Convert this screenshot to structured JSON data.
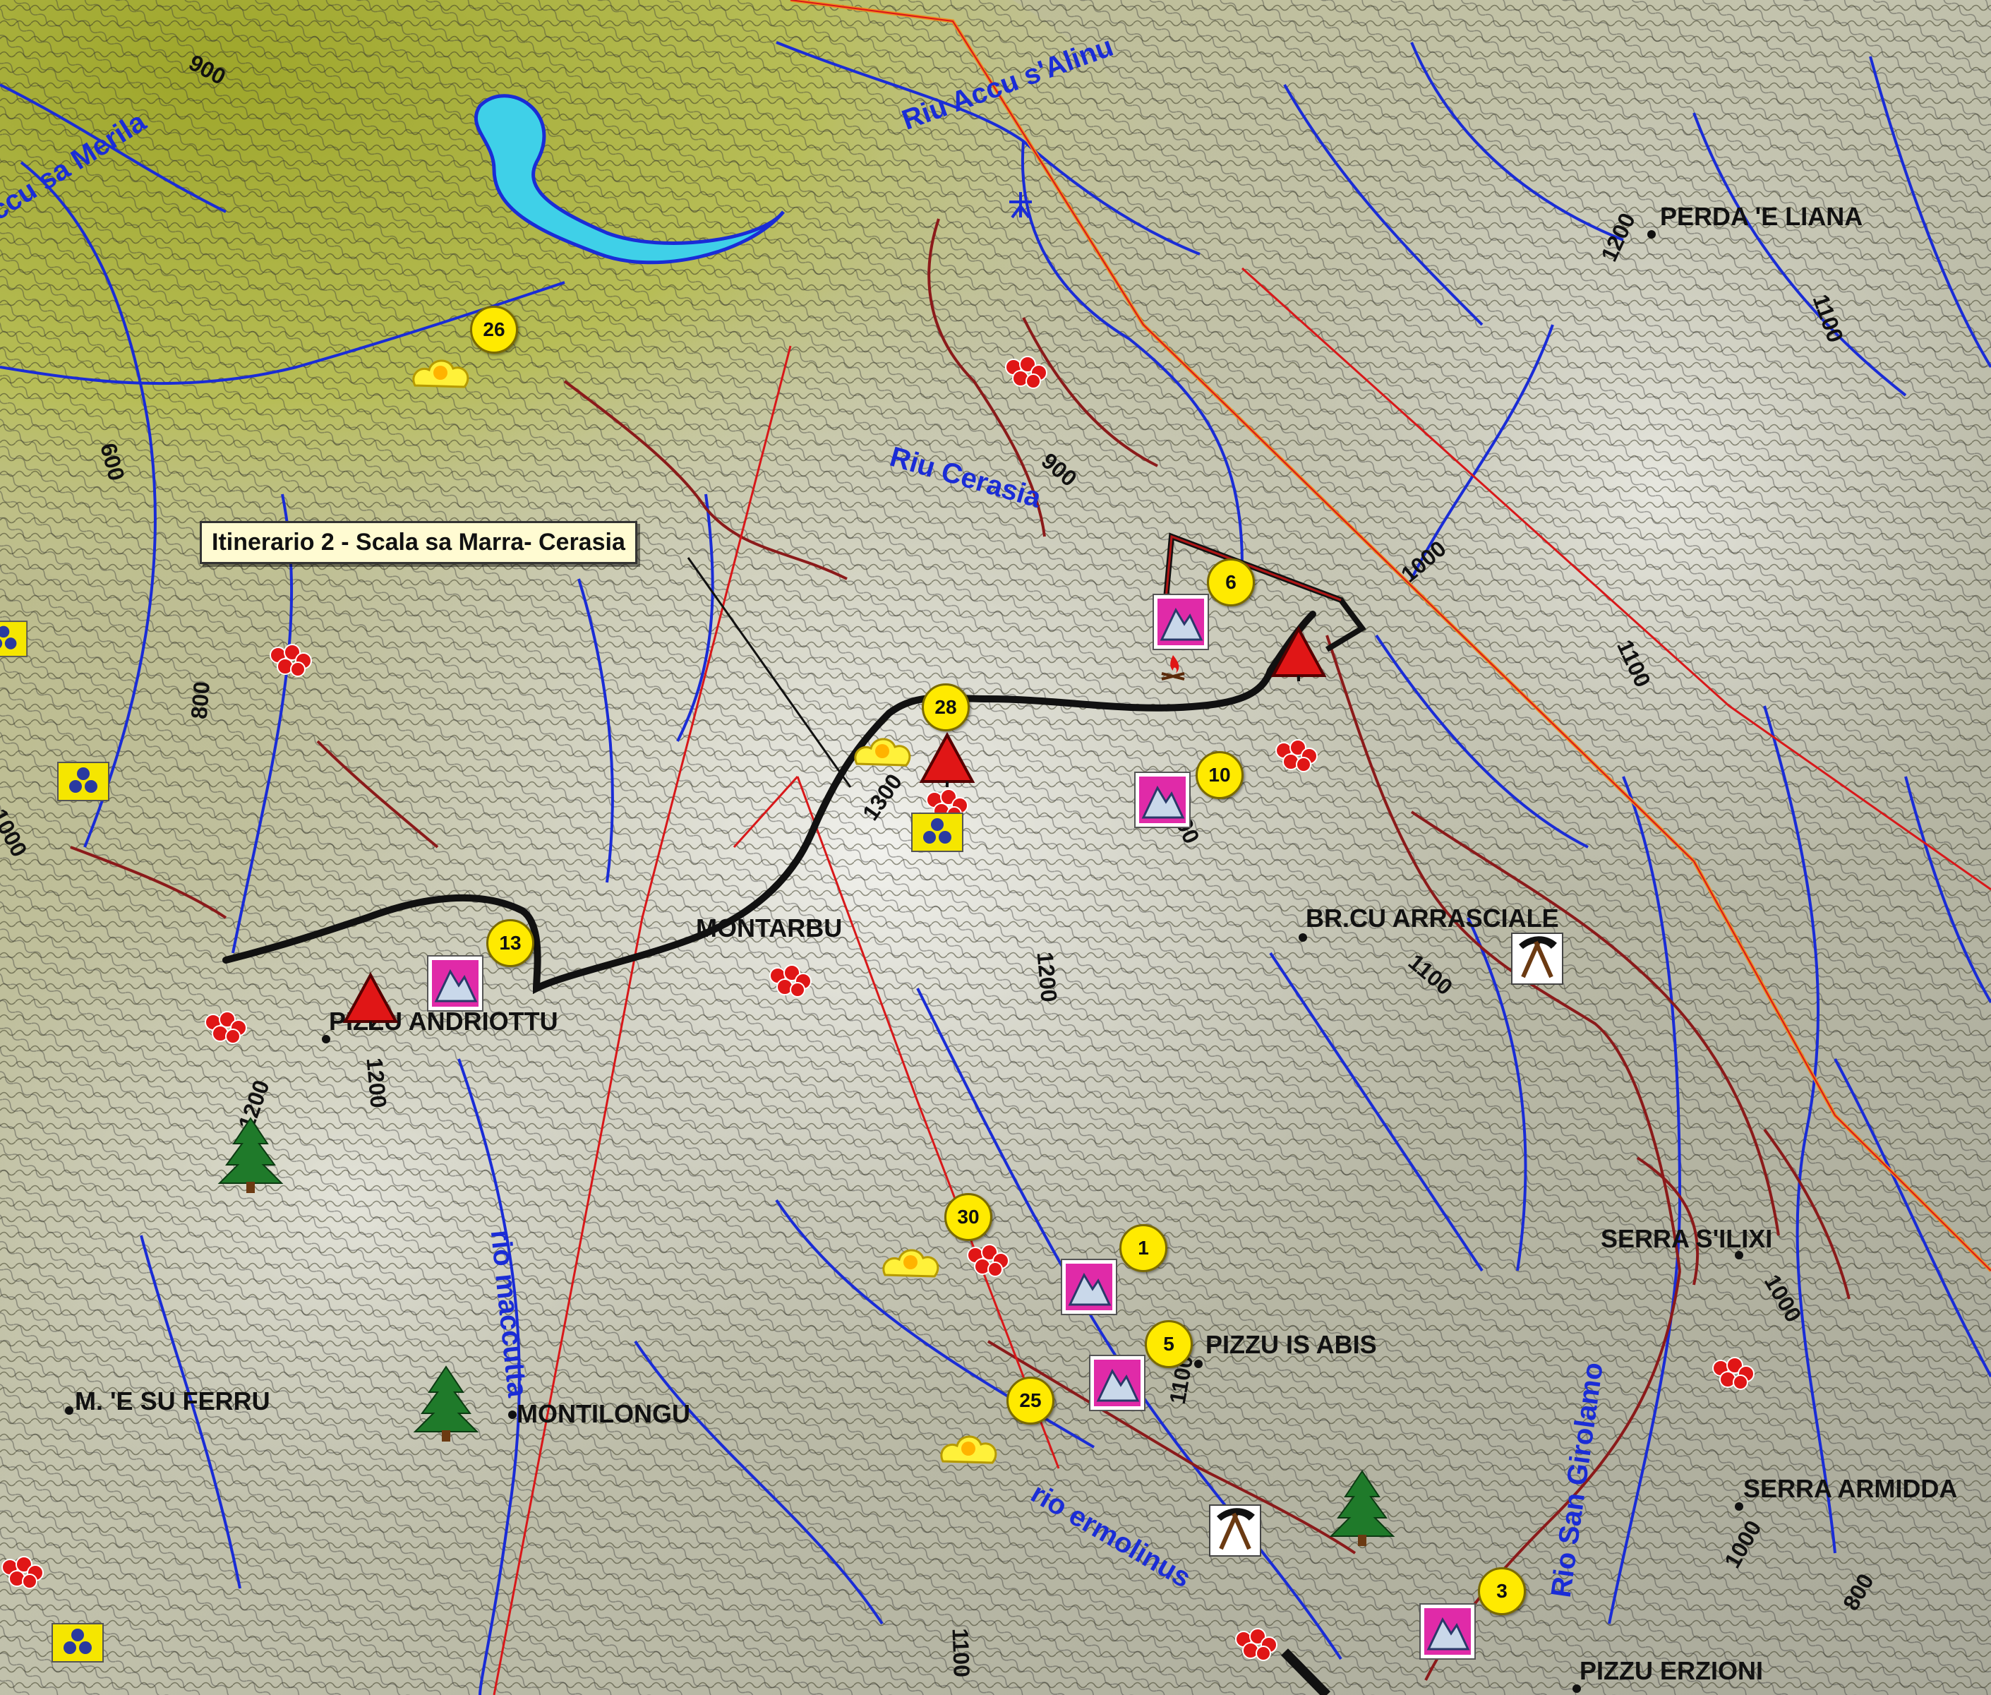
{
  "map": {
    "callout": "Itinerario 2 - Scala sa Marra- Cerasia",
    "places": [
      {
        "id": "perda-e-liana",
        "name": "PERDA 'E LIANA"
      },
      {
        "id": "br-cu-arrasciale",
        "name": "BR.CU ARRASCIALE"
      },
      {
        "id": "montarbu",
        "name": "MONTARBU"
      },
      {
        "id": "pizzu-andriottu",
        "name": "PIZZU ANDRIOTTU"
      },
      {
        "id": "serra-s-ilixi",
        "name": "SERRA S'ILIXI"
      },
      {
        "id": "pizzu-is-abis",
        "name": "PIZZU IS ABIS"
      },
      {
        "id": "m-e-su-ferru",
        "name": "M. 'E SU FERRU"
      },
      {
        "id": "montilongu",
        "name": "MONTILONGU"
      },
      {
        "id": "serra-armidda",
        "name": "SERRA ARMIDDA"
      },
      {
        "id": "pizzu-erzioni",
        "name": "PIZZU ERZIONI"
      }
    ],
    "rivers": [
      {
        "id": "riu-accu-s-alinu",
        "name": "Riu Accu s'Alinu"
      },
      {
        "id": "accu-sa-merila",
        "name": "ccu sa Merila"
      },
      {
        "id": "riu-cerasia",
        "name": "Riu Cerasia"
      },
      {
        "id": "rio-maccutta",
        "name": "rio maccutta"
      },
      {
        "id": "rio-ermolinus",
        "name": "rio ermolinus"
      },
      {
        "id": "rio-san-girolamo",
        "name": "Rio San Girolamo"
      }
    ],
    "contours": [
      {
        "id": "c900a",
        "value": "900"
      },
      {
        "id": "c600",
        "value": "600"
      },
      {
        "id": "c900b",
        "value": "900"
      },
      {
        "id": "c1000a",
        "value": "1000"
      },
      {
        "id": "c1200a",
        "value": "1200"
      },
      {
        "id": "c1100a",
        "value": "1100"
      },
      {
        "id": "c1100b",
        "value": "1100"
      },
      {
        "id": "c800a",
        "value": "800"
      },
      {
        "id": "c1000b",
        "value": "1000"
      },
      {
        "id": "c1300",
        "value": "1300"
      },
      {
        "id": "c1200b",
        "value": "1200"
      },
      {
        "id": "c1200c",
        "value": "1200"
      },
      {
        "id": "c1100c",
        "value": "1100"
      },
      {
        "id": "c1200d",
        "value": "1200"
      },
      {
        "id": "c1200e",
        "value": "1200"
      },
      {
        "id": "c1000c",
        "value": "1000"
      },
      {
        "id": "c1100d",
        "value": "1100"
      },
      {
        "id": "c1000d",
        "value": "1000"
      },
      {
        "id": "c800b",
        "value": "800"
      },
      {
        "id": "c1100e",
        "value": "1100"
      }
    ],
    "waypoints": [
      "26",
      "6",
      "28",
      "10",
      "13",
      "30",
      "1",
      "5",
      "25",
      "3"
    ],
    "icon_types": [
      "summit-triangle-icon",
      "mountain-view-icon",
      "sun-cloud-icon",
      "flower-icon",
      "fruit-cluster-icon",
      "pickaxe-icon",
      "pine-tree-icon",
      "campfire-icon"
    ]
  },
  "colors": {
    "track": "#111111",
    "trail": "#8b1a1a",
    "stream": "#1a2cd6",
    "boundary_red": "#d8181a",
    "boundary_orange": "#f08a1e",
    "lake": "#3fd0e8",
    "badge": "#ffea00",
    "callout_bg": "#fffbd2"
  }
}
